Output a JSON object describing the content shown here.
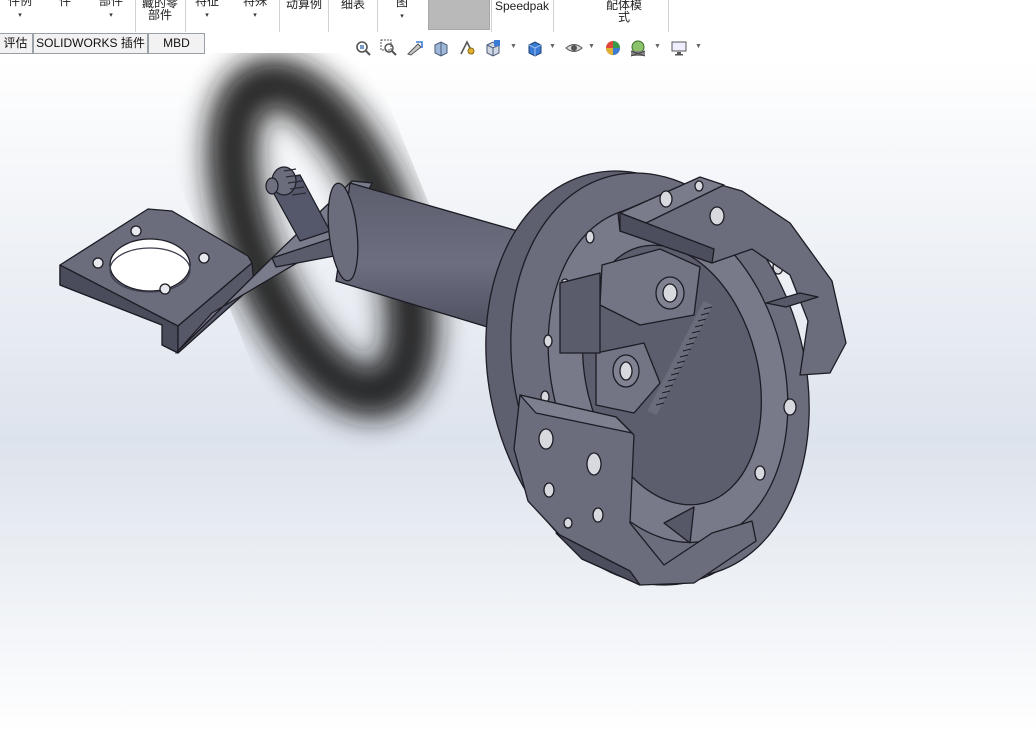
{
  "ribbon": {
    "buttons": [
      {
        "label": "件例",
        "arrow": "▾"
      },
      {
        "label": "件",
        "arrow": ""
      },
      {
        "label": "部件",
        "arrow": "▾"
      },
      {
        "label": "藏的零\n部件",
        "arrow": ""
      },
      {
        "label": "特征",
        "arrow": "▾"
      },
      {
        "label": "特殊",
        "arrow": "▾"
      },
      {
        "label": "动算例",
        "arrow": ""
      },
      {
        "label": "细表",
        "arrow": ""
      },
      {
        "label": "图",
        "arrow": "▾"
      },
      {
        "label": "Speedpak",
        "arrow": ""
      },
      {
        "label": "配体模\n式",
        "arrow": ""
      }
    ]
  },
  "tabs": [
    "评估",
    "SOLIDWORKS 插件",
    "MBD"
  ],
  "heads_up_toolbar": {
    "icons": [
      "zoom-to-fit-icon",
      "zoom-to-area-icon",
      "previous-view-icon",
      "section-view-icon",
      "dynamic-annotation-icon",
      "view-orientation-icon",
      "display-style-icon",
      "hide-show-items-icon",
      "edit-appearance-icon",
      "apply-scene-icon",
      "view-settings-icon"
    ]
  },
  "colors": {
    "part_face": "#6b6d7d",
    "part_light": "#8a8c9c",
    "part_dark": "#3e4050",
    "edge": "#1c1c24",
    "ribbon_bg": "#ffffff",
    "tab_bg": "#f2f2f2"
  }
}
